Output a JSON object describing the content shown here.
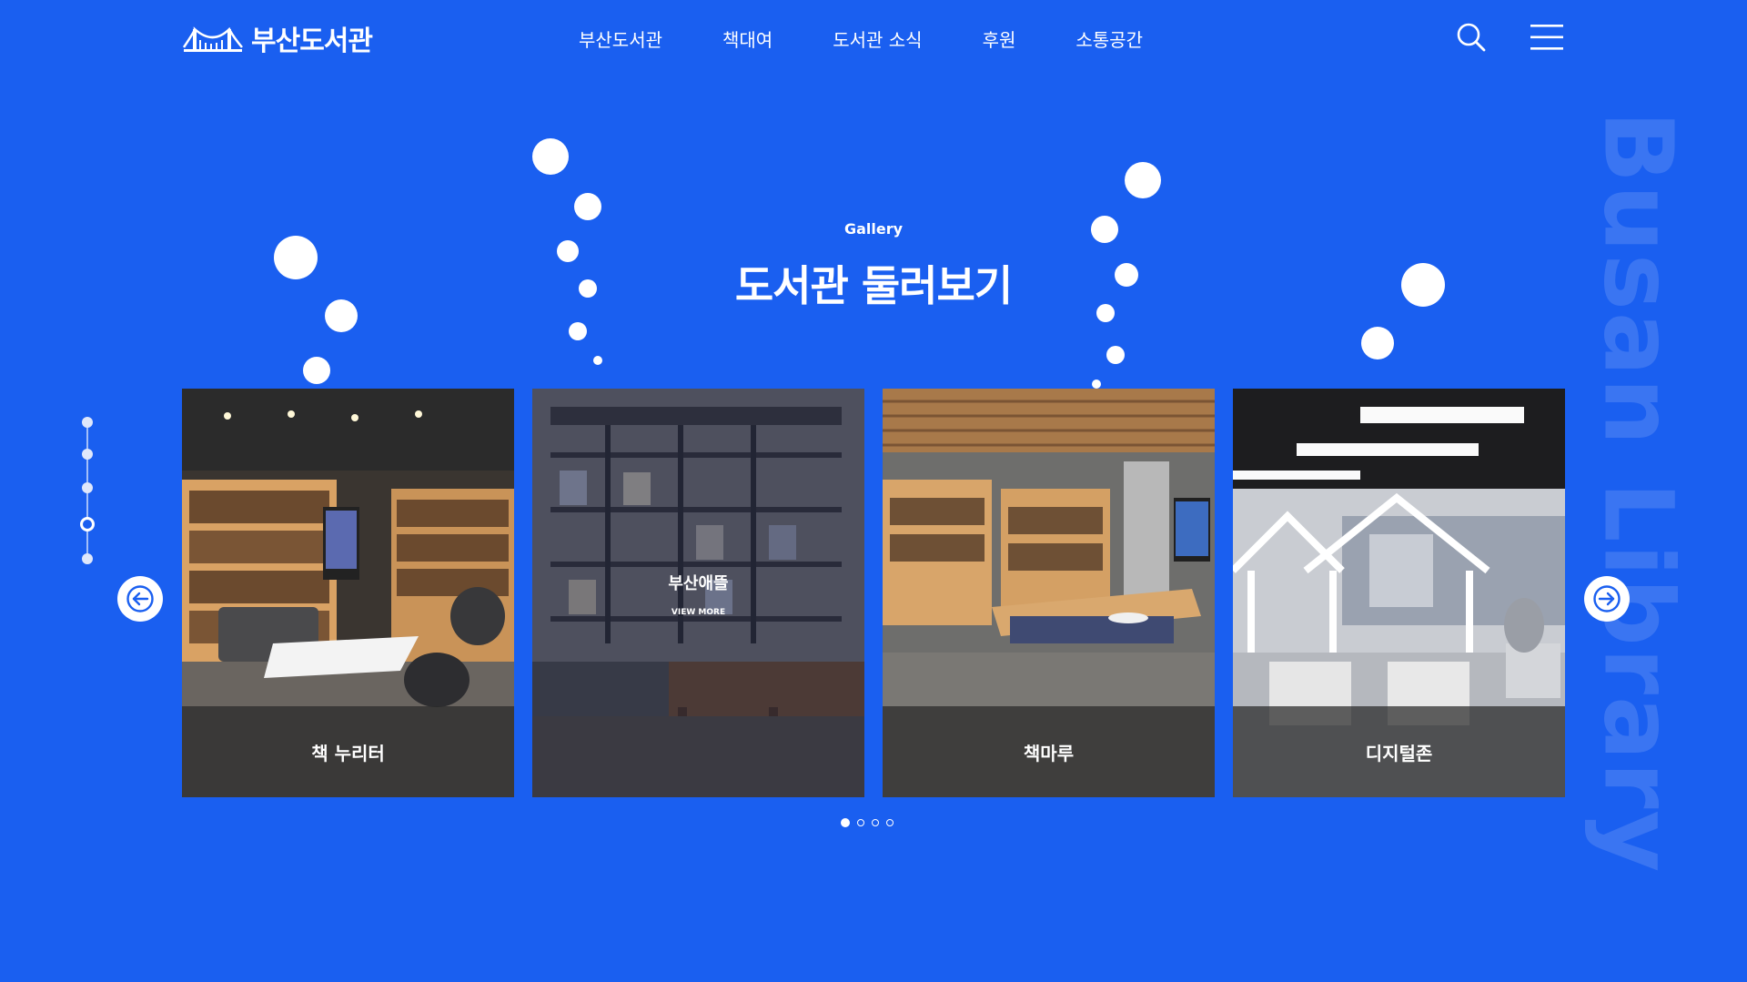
{
  "header": {
    "logo_text": "부산도서관",
    "nav": [
      {
        "label": "부산도서관"
      },
      {
        "label": "책대여"
      },
      {
        "label": "도서관 소식"
      },
      {
        "label": "후원"
      },
      {
        "label": "소통공간"
      }
    ]
  },
  "gallery": {
    "label": "Gallery",
    "title": "도서관 둘러보기",
    "watermark": "Busan Library",
    "cards": [
      {
        "caption": "책 누리터"
      },
      {
        "hover_title": "부산애뜰",
        "hover_more": "VIEW MORE"
      },
      {
        "caption": "책마루"
      },
      {
        "caption": "디지털존"
      }
    ],
    "pager": {
      "total": 4,
      "active_index": 0
    },
    "side_nav": {
      "total": 5,
      "active_index": 3
    }
  },
  "colors": {
    "background": "#1a5ff0",
    "foreground": "#ffffff"
  }
}
